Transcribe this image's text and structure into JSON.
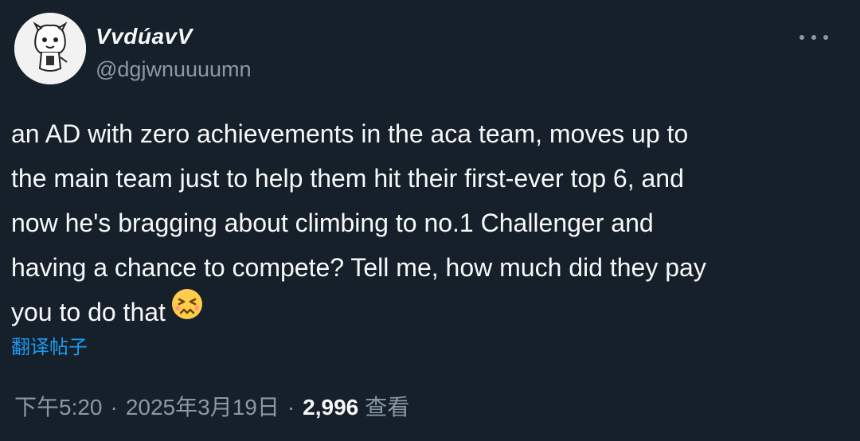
{
  "author": {
    "display_name": "VvdúavV",
    "handle": "@dgjwnuuuumn",
    "avatar_icon": "cartoon-face-avatar"
  },
  "more_icon": "more-horizontal-icon",
  "tweet": {
    "lines": [
      "an AD with zero achievements in the aca team, moves up to",
      "the main team just to help them hit their first-ever top 6, and",
      "now he's bragging about climbing to no.1 Challenger and",
      "having a chance to compete? Tell me, how much did they pay",
      "you to do that"
    ],
    "emoji": "persevering-face-emoji"
  },
  "translate_label": "翻译帖子",
  "meta": {
    "time": "下午5:20",
    "separator": "·",
    "date": "2025年3月19日",
    "views_count": "2,996",
    "views_label": "查看"
  },
  "colors": {
    "background": "#15202b",
    "text": "#f7f9f9",
    "secondary": "#8b98a5",
    "link": "#1d9bf0"
  }
}
